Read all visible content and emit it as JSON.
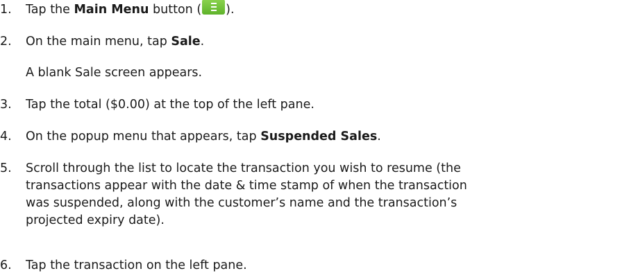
{
  "steps": [
    {
      "num": "1.",
      "prefix": "Tap the ",
      "bold": "Main Menu",
      "middle": " button (",
      "icon": "main-menu-icon",
      "suffix": ")."
    },
    {
      "num": "2.",
      "prefix": "On the main menu, tap ",
      "bold": "Sale",
      "suffix": "."
    },
    {
      "note": "A blank Sale screen appears."
    },
    {
      "num": "3.",
      "text": "Tap the total ($0.00) at the top of the left pane."
    },
    {
      "num": "4.",
      "prefix": "On the popup menu that appears, tap ",
      "bold": "Suspended Sales",
      "suffix": "."
    },
    {
      "num": "5.",
      "lines": [
        "Scroll through the list to locate the transaction you wish to resume (the",
        "transactions appear with the date & time stamp of when the transaction",
        "was suspended, along with the customer’s name and the transaction’s",
        "projected expiry date)."
      ]
    },
    {
      "num": "6.",
      "text": "Tap the transaction on the left pane."
    }
  ],
  "colors": {
    "button_green": "#6cc232",
    "text": "#1a1a1a"
  }
}
